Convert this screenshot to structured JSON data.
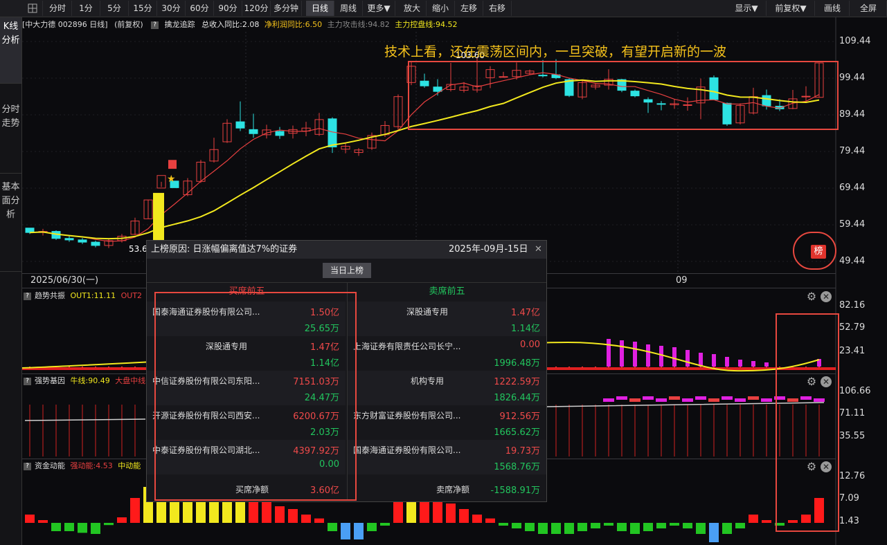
{
  "toolbar": {
    "items": [
      "分时",
      "1分",
      "5分",
      "15分",
      "30分",
      "60分",
      "90分",
      "120分",
      "多分钟",
      "日线",
      "周线",
      "更多▼",
      "放大",
      "缩小",
      "左移",
      "右移"
    ],
    "right_items": [
      "显示▼",
      "前复权▼",
      "画线",
      "全屏"
    ],
    "active": "日线"
  },
  "sidebar": {
    "tabs": [
      "K线分析",
      "分时走势",
      "基本面分析"
    ]
  },
  "info": {
    "stock": "[中大力德 002896 日线]",
    "adjust": "(前复权)",
    "indicator": "擒龙追踪",
    "revenue": "总收入同比:2.08",
    "profit": "净利润同比:6.50",
    "attack": "主力攻击线:94.82",
    "control": "主力控盘线:94.52"
  },
  "main_chart": {
    "headline": "技术上看，还在震荡区间内，一旦突破，有望开启新的一波",
    "y_ticks": [
      "109.44",
      "99.44",
      "89.44",
      "79.44",
      "69.44",
      "59.44",
      "49.44"
    ],
    "high_label": "103.60",
    "low_label": "53.6",
    "date_left": "2025/06/30(一)",
    "date_mid": "09",
    "bang_badge": "榜"
  },
  "pane1": {
    "name": "趋势共振",
    "out1": "OUT1:11.11",
    "out2": "OUT2",
    "y_ticks": [
      "82.16",
      "52.79",
      "23.41"
    ]
  },
  "pane2": {
    "name": "强势基因",
    "cow": "牛线:90.49",
    "market": "大盘中线",
    "y_ticks": [
      "106.66",
      "71.11",
      "35.55"
    ]
  },
  "pane3": {
    "name": "资金动能",
    "strong": "强动能:4.53",
    "mid": "中动能",
    "y_ticks": [
      "12.76",
      "7.09",
      "1.43"
    ]
  },
  "popup": {
    "title": "上榜原因: 日涨幅偏离值达7%的证券",
    "date": "2025年-09月-15日",
    "close": "✕",
    "tab_btn": "当日上榜",
    "buy_header": "买席前五",
    "sell_header": "卖席前五",
    "buy": [
      {
        "name": "国泰海通证券股份有限公司...",
        "v1": "1.50亿",
        "v2": "25.65万"
      },
      {
        "name": "深股通专用",
        "v1": "1.47亿",
        "v2": "1.14亿"
      },
      {
        "name": "中信证券股份有限公司东阳...",
        "v1": "7151.03万",
        "v2": "24.47万"
      },
      {
        "name": "开源证券股份有限公司西安...",
        "v1": "6200.67万",
        "v2": "2.03万"
      },
      {
        "name": "中泰证券股份有限公司湖北...",
        "v1": "4397.92万",
        "v2": "0.00"
      }
    ],
    "sell": [
      {
        "name": "深股通专用",
        "v1": "1.47亿",
        "v2": "1.14亿"
      },
      {
        "name": "上海证券有限责任公司长宁...",
        "v1": "0.00",
        "v2": "1996.48万"
      },
      {
        "name": "机构专用",
        "v1": "1222.59万",
        "v2": "1826.44万"
      },
      {
        "name": "东方财富证券股份有限公司...",
        "v1": "912.56万",
        "v2": "1665.62万"
      },
      {
        "name": "国泰海通证券股份有限公司...",
        "v1": "19.73万",
        "v2": "1568.76万"
      }
    ],
    "buy_net_label": "买席净额",
    "buy_net": "3.60亿",
    "sell_net_label": "卖席净额",
    "sell_net": "-1588.91万"
  },
  "chart_data": [
    {
      "type": "candlestick",
      "title": "中大力德 002896 日线",
      "ylim": [
        47,
        112
      ],
      "ohlc": [
        [
          59.0,
          59.0,
          57.4,
          57.8
        ],
        [
          57.8,
          58.8,
          57.0,
          58.1
        ],
        [
          58.1,
          58.4,
          55.8,
          56.2
        ],
        [
          56.2,
          56.9,
          55.3,
          55.8
        ],
        [
          55.8,
          56.3,
          54.7,
          55.2
        ],
        [
          55.2,
          55.6,
          53.8,
          54.3
        ],
        [
          54.3,
          56.1,
          53.6,
          55.6
        ],
        [
          55.6,
          57.4,
          55.1,
          56.8
        ],
        [
          57.3,
          61.8,
          57.1,
          60.9
        ],
        [
          61.5,
          66.6,
          61.5,
          66.6
        ],
        [
          69.8,
          70.1,
          71.5,
          73.2
        ],
        [
          71.7,
          71.7,
          69.9,
          69.9
        ],
        [
          68.0,
          72.5,
          67.6,
          71.7
        ],
        [
          71.6,
          77.4,
          71.2,
          76.8
        ],
        [
          77.1,
          83.4,
          76.7,
          80.2
        ],
        [
          82.3,
          88.4,
          82.0,
          87.3
        ],
        [
          87.7,
          93.2,
          85.2,
          86.0
        ],
        [
          85.6,
          89.9,
          83.4,
          84.5
        ],
        [
          84.2,
          86.9,
          83.2,
          85.5
        ],
        [
          85.1,
          86.3,
          83.1,
          84.0
        ],
        [
          84.6,
          86.7,
          83.2,
          85.6
        ],
        [
          85.2,
          87.7,
          83.8,
          86.0
        ],
        [
          84.3,
          90.1,
          83.9,
          88.3
        ],
        [
          88.5,
          88.9,
          79.3,
          80.9
        ],
        [
          80.3,
          82.0,
          79.2,
          81.1
        ],
        [
          79.4,
          80.6,
          78.5,
          80.1
        ],
        [
          80.6,
          84.8,
          80.1,
          84.0
        ],
        [
          84.2,
          87.9,
          83.6,
          86.7
        ],
        [
          86.4,
          95.1,
          85.4,
          94.5
        ],
        [
          98.3,
          104.0,
          97.6,
          102.7
        ],
        [
          98.7,
          100.7,
          96.9,
          97.4
        ],
        [
          97.1,
          99.2,
          94.8,
          95.9
        ],
        [
          96.4,
          103.6,
          95.9,
          97.8
        ],
        [
          96.2,
          98.4,
          95.6,
          97.1
        ],
        [
          96.3,
          104.9,
          95.6,
          97.4
        ],
        [
          99.6,
          102.7,
          96.8,
          101.8
        ],
        [
          99.9,
          101.2,
          99.6,
          99.9
        ],
        [
          99.9,
          103.7,
          99.1,
          101.6
        ],
        [
          100.8,
          101.8,
          100.4,
          101.4
        ],
        [
          100.3,
          104.4,
          99.7,
          100.1
        ],
        [
          100.4,
          104.6,
          99.2,
          99.6
        ],
        [
          99.1,
          99.5,
          94.4,
          94.8
        ],
        [
          94.4,
          98.9,
          93.8,
          98.3
        ],
        [
          97.1,
          98.0,
          96.4,
          97.6
        ],
        [
          97.6,
          101.9,
          96.4,
          99.2
        ],
        [
          99.1,
          99.3,
          95.7,
          96.2
        ],
        [
          96.0,
          96.4,
          94.3,
          94.7
        ],
        [
          93.7,
          94.3,
          90.1,
          93.0
        ],
        [
          92.6,
          93.3,
          90.8,
          92.5
        ],
        [
          92.3,
          93.7,
          91.2,
          92.6
        ],
        [
          92.3,
          94.3,
          90.7,
          92.3
        ],
        [
          92.8,
          99.4,
          88.4,
          97.1
        ],
        [
          99.6,
          100.2,
          93.7,
          93.7
        ],
        [
          92.7,
          92.9,
          86.6,
          87.1
        ],
        [
          87.4,
          92.7,
          87.0,
          92.1
        ],
        [
          90.1,
          96.9,
          89.7,
          94.5
        ],
        [
          94.8,
          96.4,
          91.0,
          92.0
        ],
        [
          91.9,
          93.8,
          90.6,
          91.2
        ],
        [
          91.3,
          96.3,
          91.1,
          93.9
        ],
        [
          94.5,
          97.3,
          92.8,
          94.6
        ],
        [
          94.3,
          103.6,
          94.3,
          103.6
        ]
      ],
      "ma_red_label": "主力攻击线",
      "ma_yellow_label": "主力控盘线"
    },
    {
      "type": "line",
      "name": "趋势共振",
      "ylim": [
        0,
        90
      ],
      "series": [
        {
          "name": "OUT1",
          "values": [
            11.11
          ]
        }
      ]
    },
    {
      "type": "bar",
      "name": "强势基因",
      "ylim": [
        0,
        115
      ],
      "series": [
        {
          "name": "牛线",
          "values": [
            90.49
          ]
        }
      ]
    },
    {
      "type": "bar",
      "name": "资金动能",
      "ylim": [
        -3,
        15
      ],
      "series": [
        {
          "name": "强动能",
          "values": [
            4.53
          ]
        }
      ]
    }
  ],
  "colors": {
    "up": "#e84040",
    "down": "#2de3e3",
    "ma_red": "#e84040",
    "ma_yellow": "#f2e81e",
    "highlight": "#e8483f",
    "accent_text": "#f5c21b"
  }
}
